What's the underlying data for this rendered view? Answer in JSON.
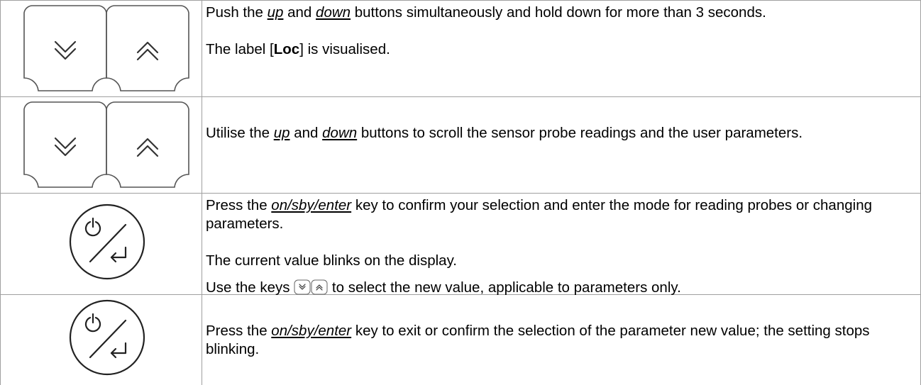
{
  "rows": [
    {
      "icon": "up-down-keys",
      "line1_pre": "Push the ",
      "up": "up",
      "and": " and ",
      "down": "down",
      "line1_post": " buttons simultaneously and hold down for more than 3 seconds.",
      "line2_pre": "The label [",
      "label_bold": "Loc",
      "line2_post": "] is visualised."
    },
    {
      "icon": "up-down-keys",
      "pre": "Utilise the ",
      "up": "up",
      "and": " and ",
      "down": "down",
      "post": " buttons to scroll the sensor probe readings and the user parameters."
    },
    {
      "icon": "power-enter-key",
      "pre": "Press the ",
      "key": "on/sby/enter",
      "post": " key to confirm your selection and enter the mode for reading probes or changing parameters.",
      "blink": "The current value blinks on the display.",
      "keys_pre": "Use the keys ",
      "keys_post": " to select the new value, applicable to parameters only."
    },
    {
      "icon": "power-enter-key",
      "pre": "Press the ",
      "key": "on/sby/enter",
      "post": " key to exit or confirm the selection of the parameter new value; the setting stops blinking."
    }
  ]
}
